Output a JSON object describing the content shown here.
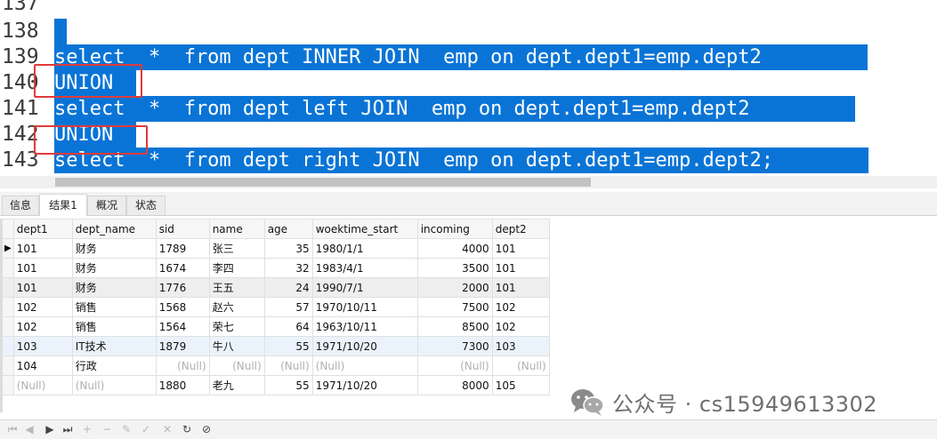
{
  "editor": {
    "lines": [
      {
        "num": "137",
        "code": ""
      },
      {
        "num": "138",
        "code": ""
      },
      {
        "num": "139",
        "code": "select  *  from dept INNER JOIN  emp on dept.dept1=emp.dept2"
      },
      {
        "num": "140",
        "code": "UNION"
      },
      {
        "num": "141",
        "code": "select  *  from dept left JOIN  emp on dept.dept1=emp.dept2"
      },
      {
        "num": "142",
        "code": "UNION"
      },
      {
        "num": "143",
        "code": "select  *  from dept right JOIN  emp on dept.dept1=emp.dept2;"
      }
    ]
  },
  "tabs": [
    "信息",
    "结果1",
    "概况",
    "状态"
  ],
  "grid": {
    "columns": [
      "dept1",
      "dept_name",
      "sid",
      "name",
      "age",
      "woektime_start",
      "incoming",
      "dept2"
    ],
    "rows": [
      [
        "101",
        "财务",
        "1789",
        "张三",
        "35",
        "1980/1/1",
        "4000",
        "101"
      ],
      [
        "101",
        "财务",
        "1674",
        "李四",
        "32",
        "1983/4/1",
        "3500",
        "101"
      ],
      [
        "101",
        "财务",
        "1776",
        "王五",
        "24",
        "1990/7/1",
        "2000",
        "101"
      ],
      [
        "102",
        "销售",
        "1568",
        "赵六",
        "57",
        "1970/10/11",
        "7500",
        "102"
      ],
      [
        "102",
        "销售",
        "1564",
        "荣七",
        "64",
        "1963/10/11",
        "8500",
        "102"
      ],
      [
        "103",
        "IT技术",
        "1879",
        "牛八",
        "55",
        "1971/10/20",
        "7300",
        "103"
      ],
      [
        "104",
        "行政",
        "(Null)",
        "(Null)",
        "(Null)",
        "(Null)",
        "(Null)",
        "(Null)"
      ],
      [
        "(Null)",
        "(Null)",
        "1880",
        "老九",
        "55",
        "1971/10/20",
        "8000",
        "105"
      ]
    ]
  },
  "watermark": "公众号 · cs15949613302",
  "colors": {
    "selection": "#0a74d6",
    "highlight_box": "#e03a3a"
  }
}
